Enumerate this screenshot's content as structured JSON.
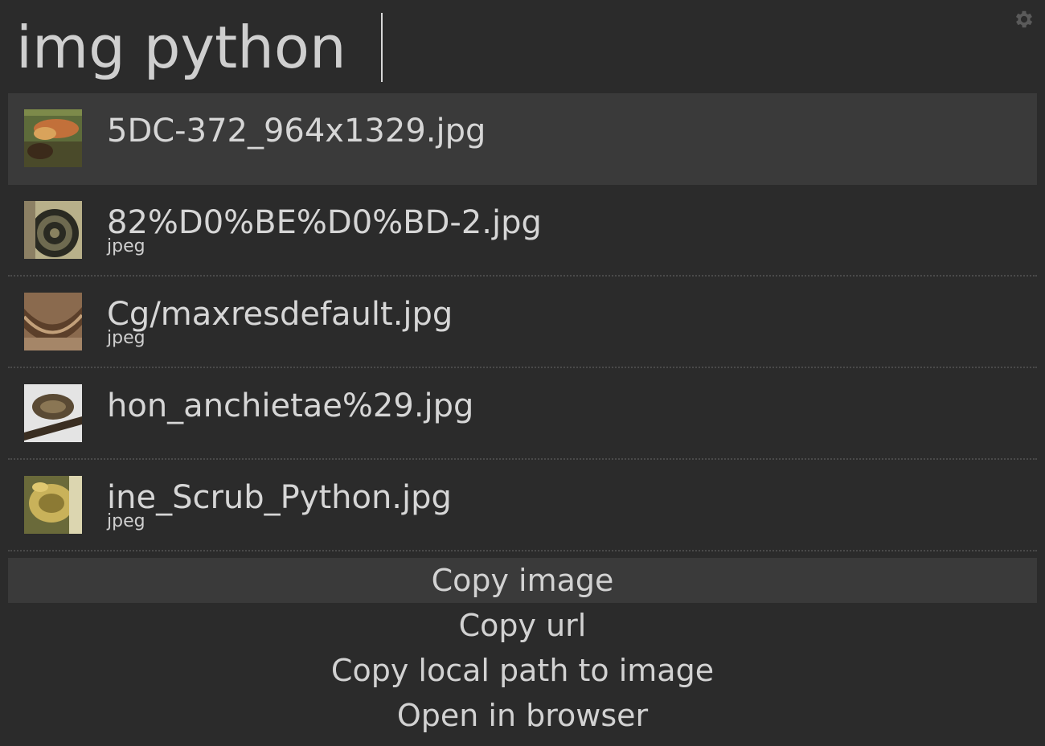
{
  "search": {
    "query": "img python"
  },
  "settings": {
    "icon": "gear-icon",
    "color": "#5a5a5a"
  },
  "results": [
    {
      "title": "5DC-372_964x1329.jpg",
      "subtitle": "",
      "thumbnail": "python-head-photo"
    },
    {
      "title": "82%D0%BE%D0%BD-2.jpg",
      "subtitle": "jpeg",
      "thumbnail": "coiled-python-photo"
    },
    {
      "title": "Cg/maxresdefault.jpg",
      "subtitle": "jpeg",
      "thumbnail": "patterned-python-photo"
    },
    {
      "title": "hon_anchietae%29.jpg",
      "subtitle": "",
      "thumbnail": "python-on-branch-photo"
    },
    {
      "title": "ine_Scrub_Python.jpg",
      "subtitle": "jpeg",
      "thumbnail": "yellow-python-photo"
    }
  ],
  "actions": [
    {
      "label": "Copy image"
    },
    {
      "label": "Copy url"
    },
    {
      "label": "Copy local path to image"
    },
    {
      "label": "Open in browser"
    }
  ],
  "colors": {
    "background": "#2b2b2b",
    "selected": "#3a3a3a",
    "text": "#d6d6d6"
  }
}
